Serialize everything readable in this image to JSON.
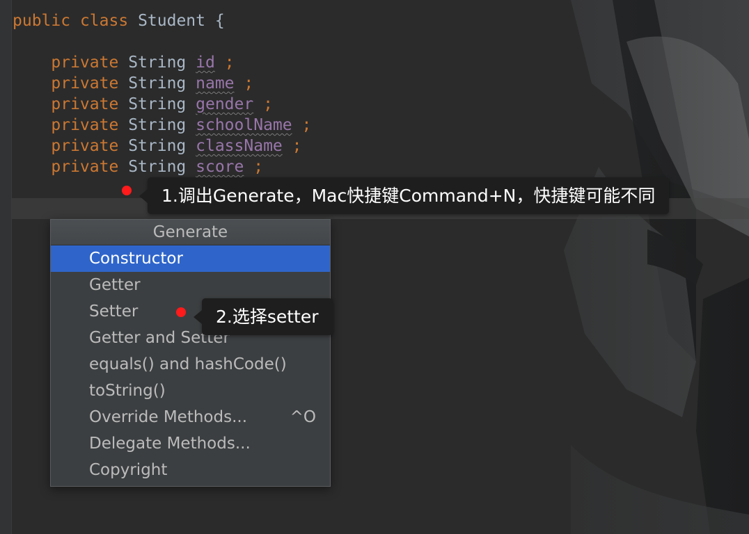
{
  "editor": {
    "class_decl": {
      "kw1": "public",
      "kw2": "class",
      "name": "Student",
      "brace": "{"
    },
    "fields": [
      {
        "modifier": "private",
        "type": "String",
        "name": "id",
        "semi": ";"
      },
      {
        "modifier": "private",
        "type": "String",
        "name": "name",
        "semi": ";"
      },
      {
        "modifier": "private",
        "type": "String",
        "name": "gender",
        "semi": ";"
      },
      {
        "modifier": "private",
        "type": "String",
        "name": "schoolName",
        "semi": ";"
      },
      {
        "modifier": "private",
        "type": "String",
        "name": "className",
        "semi": ";"
      },
      {
        "modifier": "private",
        "type": "String",
        "name": "score",
        "semi": ";"
      }
    ]
  },
  "generate_popup": {
    "title": "Generate",
    "items": [
      {
        "label": "Constructor",
        "selected": true
      },
      {
        "label": "Getter"
      },
      {
        "label": "Setter"
      },
      {
        "label": "Getter and Setter"
      },
      {
        "label": "equals() and hashCode()"
      },
      {
        "label": "toString()"
      },
      {
        "label": "Override Methods...",
        "shortcut": "^O"
      },
      {
        "label": "Delegate Methods..."
      },
      {
        "label": "Copyright"
      }
    ]
  },
  "annotations": {
    "step1": "1.调出Generate，Mac快捷键Command+N，快捷键可能不同",
    "step2": "2.选择setter",
    "marker_color": "#ff1b1b"
  },
  "colors": {
    "editor_bg": "#2b2b2b",
    "keyword": "#cc7832",
    "field": "#9876aa",
    "selection": "#2f65ca"
  }
}
